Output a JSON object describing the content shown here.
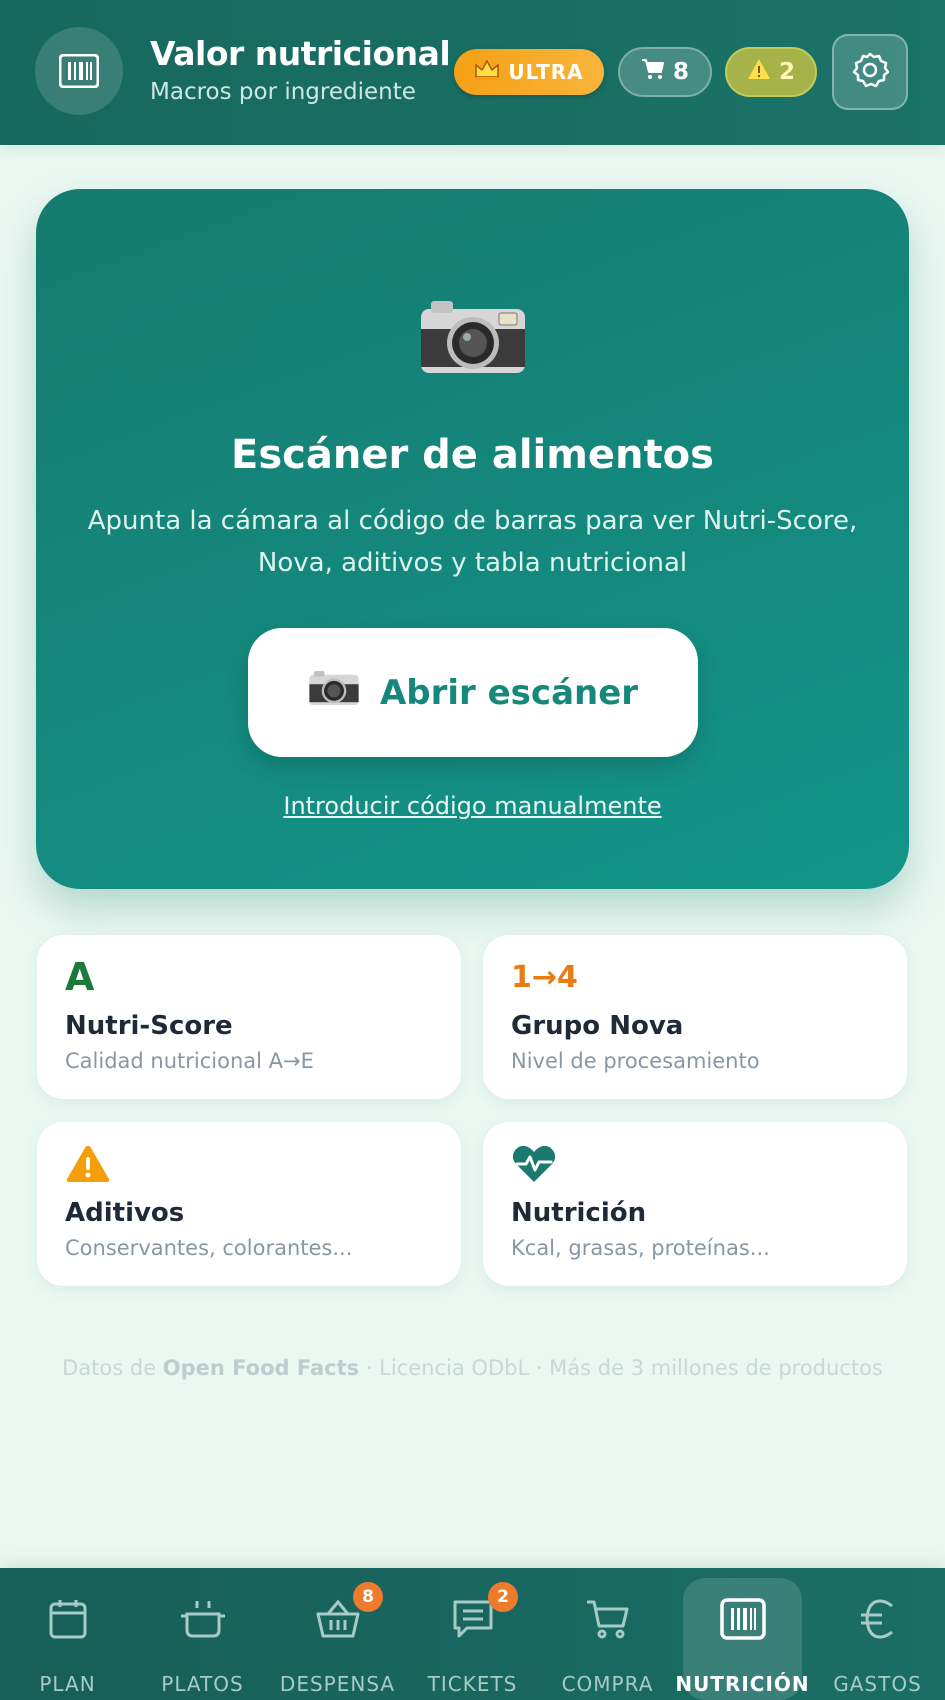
{
  "header": {
    "title": "Valor nutricional",
    "subtitle": "Macros por ingrediente",
    "plan_badge": "ULTRA",
    "cart_count": "8",
    "alert_count": "2",
    "icons": {
      "logo": "barcode-scan-icon",
      "plan": "crown-icon",
      "cart": "cart-icon",
      "alert": "warning-icon",
      "settings": "gear-icon"
    }
  },
  "hero": {
    "title": "Escáner de alimentos",
    "description": "Apunta la cámara al código de barras para ver Nutri-Score, Nova, aditivos y tabla nutricional",
    "button_label": "Abrir escáner",
    "manual_link": "Introducir código manualmente",
    "icon": "camera-icon"
  },
  "features": [
    {
      "symbol": "A",
      "title": "Nutri-Score",
      "description": "Calidad nutricional A→E"
    },
    {
      "symbol": "1→4",
      "title": "Grupo Nova",
      "description": "Nivel de procesamiento"
    },
    {
      "symbol": "warning-icon",
      "title": "Aditivos",
      "description": "Conservantes, colorantes..."
    },
    {
      "symbol": "heart-pulse-icon",
      "title": "Nutrición",
      "description": "Kcal, grasas, proteínas..."
    }
  ],
  "footer": {
    "prefix": "Datos de ",
    "source": "Open Food Facts",
    "suffix": " · Licencia ODbL · Más de 3 millones de productos"
  },
  "nav": [
    {
      "label": "PLAN",
      "icon": "calendar-icon",
      "badge": ""
    },
    {
      "label": "PLATOS",
      "icon": "pot-icon",
      "badge": ""
    },
    {
      "label": "DESPENSA",
      "icon": "basket-icon",
      "badge": "8"
    },
    {
      "label": "TICKETS",
      "icon": "receipt-icon",
      "badge": "2"
    },
    {
      "label": "COMPRA",
      "icon": "cart-icon",
      "badge": ""
    },
    {
      "label": "NUTRICIÓN",
      "icon": "barcode-scan-icon",
      "badge": "",
      "active": true
    },
    {
      "label": "GASTOS",
      "icon": "euro-icon",
      "badge": ""
    }
  ],
  "colors": {
    "primary": "#17685f",
    "hero": "#13958a",
    "accent_orange": "#ee7a2b",
    "nutriscore_green": "#1b7a3a"
  }
}
